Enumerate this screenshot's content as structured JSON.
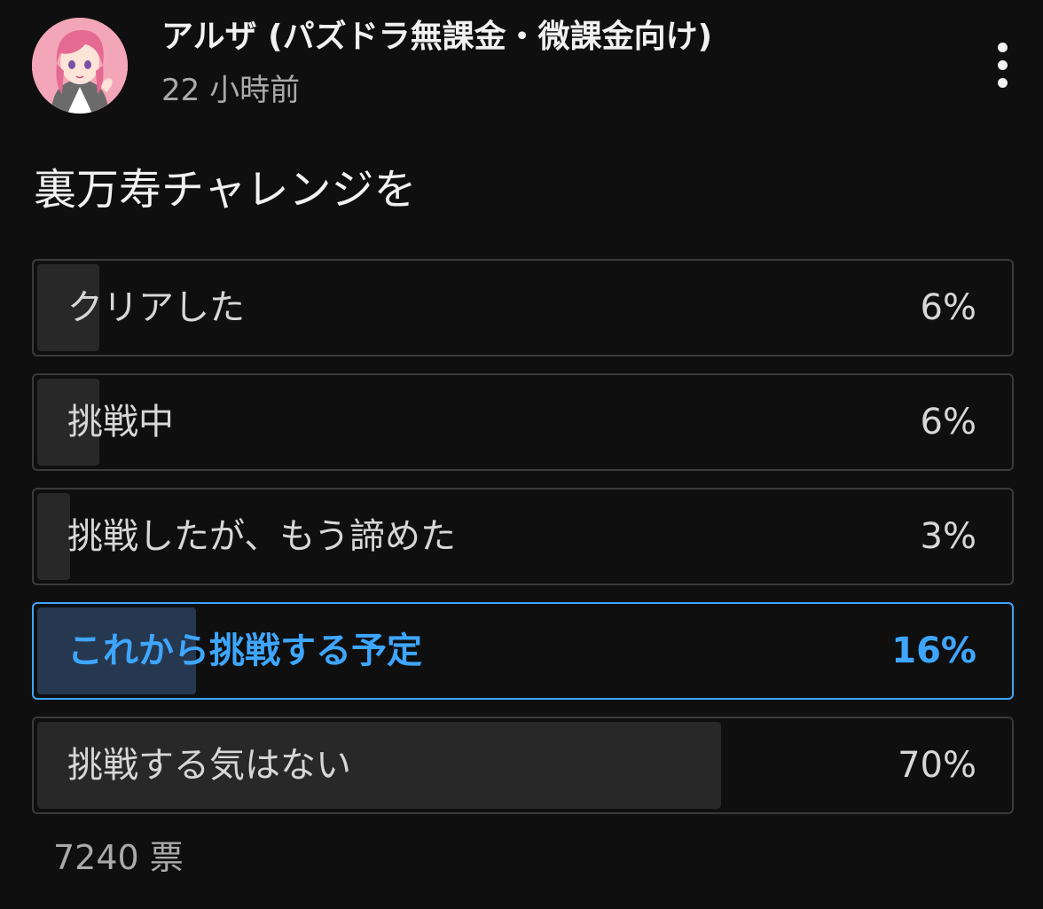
{
  "post": {
    "author": "アルザ (パズドラ無課金・微課金向け)",
    "timestamp": "22 小時前",
    "avatar_icon": "anime-girl-avatar",
    "menu_icon": "vertical-dots-icon"
  },
  "poll": {
    "question": "裏万寿チャレンジを",
    "options": [
      {
        "label": "クリアした",
        "percent_label": "6%",
        "percent": 6,
        "selected": false
      },
      {
        "label": "挑戦中",
        "percent_label": "6%",
        "percent": 6,
        "selected": false
      },
      {
        "label": "挑戦したが、もう諦めた",
        "percent_label": "3%",
        "percent": 3,
        "selected": false
      },
      {
        "label": "これから挑戦する予定",
        "percent_label": "16%",
        "percent": 16,
        "selected": true
      },
      {
        "label": "挑戦する気はない",
        "percent_label": "70%",
        "percent": 70,
        "selected": false
      }
    ],
    "total_votes": "7240 票"
  },
  "colors": {
    "background": "#0f0f0f",
    "accent": "#3ea6ff",
    "bar_fill": "#282828",
    "selected_fill": "#263850"
  }
}
